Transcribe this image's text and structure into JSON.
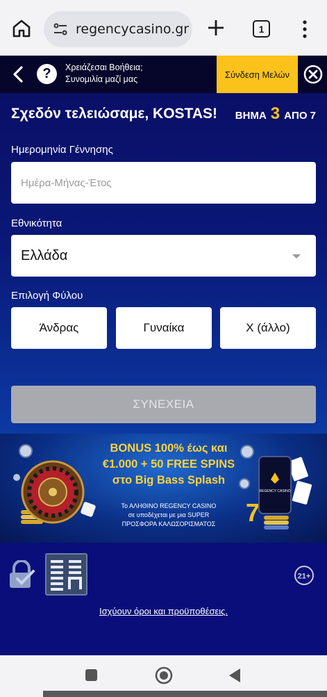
{
  "browser": {
    "url": "regencycasino.gr",
    "tab_count": "1"
  },
  "topbar": {
    "help_line1": "Χρειάζεσαι Βοήθεια;",
    "help_line2": "Συνομιλία μαζί μας",
    "login_label": "Σύνδεση Μελών"
  },
  "form": {
    "headline": "Σχεδόν τελειώσαμε, KOSTAS!",
    "step_prefix": "ΒΗΜΑ",
    "step_current": "3",
    "step_suffix": "ΑΠΟ 7",
    "dob_label": "Ημερομηνία Γέννησης",
    "dob_placeholder": "Ημέρα-Μήνας-Έτος",
    "nationality_label": "Εθνικότητα",
    "nationality_value": "Ελλάδα",
    "gender_label": "Επιλογή Φύλου",
    "gender_options": [
      "Άνδρας",
      "Γυναίκα",
      "Χ (άλλο)"
    ],
    "continue_label": "ΣΥΝΕΧΕΙΑ"
  },
  "promo": {
    "line1": "BONUS 100% έως και",
    "line2": "€1.000 + 50 FREE SPINS",
    "line3": "στο Big Bass Splash",
    "sub1": "Το ΑΛΗΘΙΝΟ REGENCY CASINO",
    "sub2": "σε υποδέχεται με μια SUPER",
    "sub3": "ΠΡΟΣΦΟΡΑ ΚΑΛΩΣΟΡΙΣΜΑΤΟΣ",
    "phone_brand": "REGENCY CASINO"
  },
  "footer": {
    "age_badge": "21+",
    "terms_link": "Ισχύουν όροι και προϋποθέσεις."
  },
  "colors": {
    "accent_yellow": "#fbc21b",
    "background_navy": "#0b0f7a",
    "topbar_dark": "#05062a"
  }
}
